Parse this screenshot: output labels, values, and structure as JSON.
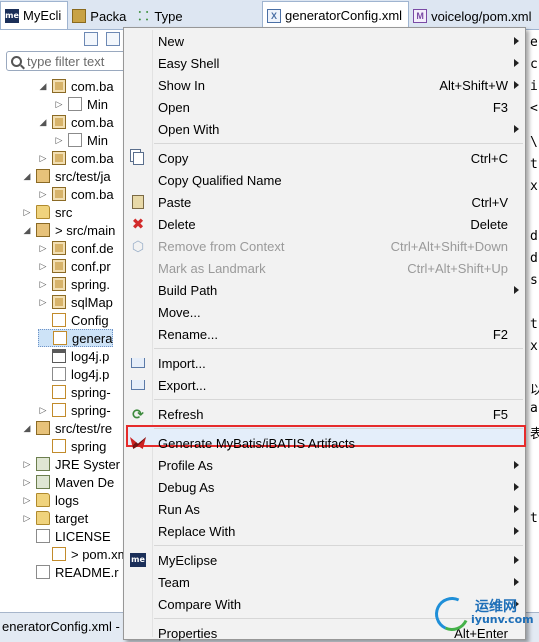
{
  "tabs_left": [
    {
      "label": "MyEcli",
      "icon": "myeclipse-icon"
    },
    {
      "label": "Packa",
      "icon": "package-explorer-icon"
    },
    {
      "label": "Type",
      "icon": "type-hierarchy-icon"
    }
  ],
  "tabs_right": [
    {
      "label": "generatorConfig.xml",
      "icon": "xml-file-icon"
    },
    {
      "label": "voicelog/pom.xml",
      "icon": "maven-pom-icon"
    }
  ],
  "explorer": {
    "filter_placeholder": "type filter text",
    "tree": [
      {
        "label": "com.ba",
        "icon": "package-icon",
        "arrow": "expanded"
      },
      {
        "label": "Min",
        "icon": "java-file-icon",
        "arrow": "collapsed"
      },
      {
        "label": "com.ba",
        "icon": "package-icon",
        "arrow": "expanded"
      },
      {
        "label": "Min",
        "icon": "java-file-icon",
        "arrow": "collapsed"
      },
      {
        "label": "com.ba",
        "icon": "package-icon",
        "arrow": "collapsed"
      },
      {
        "label": "src/test/ja",
        "icon": "source-folder-icon",
        "arrow": "expanded"
      },
      {
        "label": "com.ba",
        "icon": "package-icon",
        "arrow": "collapsed"
      },
      {
        "label": "src",
        "icon": "folder-icon",
        "arrow": "collapsed"
      },
      {
        "label": "> src/main",
        "icon": "source-folder-icon",
        "arrow": "expanded"
      },
      {
        "label": "conf.de",
        "icon": "package-icon",
        "arrow": "collapsed"
      },
      {
        "label": "conf.pr",
        "icon": "package-icon",
        "arrow": "collapsed"
      },
      {
        "label": "spring.",
        "icon": "package-icon",
        "arrow": "collapsed"
      },
      {
        "label": "sqlMap",
        "icon": "package-icon",
        "arrow": "collapsed"
      },
      {
        "label": "Config",
        "icon": "xml-file-icon",
        "arrow": "none"
      },
      {
        "label": "genera",
        "icon": "xml-file-icon",
        "arrow": "none",
        "selected": true
      },
      {
        "label": "log4j.p",
        "icon": "properties-file-icon",
        "arrow": "none"
      },
      {
        "label": "log4j.p",
        "icon": "file-icon",
        "arrow": "none"
      },
      {
        "label": "spring-",
        "icon": "xml-file-icon",
        "arrow": "none"
      },
      {
        "label": "spring-",
        "icon": "xml-file-icon",
        "arrow": "collapsed"
      },
      {
        "label": "src/test/re",
        "icon": "source-folder-icon",
        "arrow": "expanded"
      },
      {
        "label": "spring",
        "icon": "xml-file-icon",
        "arrow": "none"
      },
      {
        "label": "JRE Syster",
        "icon": "library-icon",
        "arrow": "collapsed"
      },
      {
        "label": "Maven De",
        "icon": "library-icon",
        "arrow": "collapsed"
      },
      {
        "label": "logs",
        "icon": "folder-icon",
        "arrow": "collapsed"
      },
      {
        "label": "target",
        "icon": "folder-icon",
        "arrow": "collapsed"
      },
      {
        "label": "LICENSE",
        "icon": "file-icon",
        "arrow": "none"
      },
      {
        "label": "> pom.xm",
        "icon": "maven-pom-icon",
        "arrow": "none"
      },
      {
        "label": "README.r",
        "icon": "file-icon",
        "arrow": "none"
      }
    ]
  },
  "editor_fragments": [
    "e",
    "c",
    "i",
    "<",
    "\\",
    "t",
    "x",
    "d",
    "d",
    "s",
    "t",
    "x",
    "以",
    "a",
    "表",
    "t"
  ],
  "context_menu": [
    {
      "label": "New",
      "shortcut": "",
      "submenu": true,
      "icon": "",
      "enabled": true
    },
    {
      "label": "Easy Shell",
      "shortcut": "",
      "submenu": true,
      "icon": "",
      "enabled": true
    },
    {
      "label": "Show In",
      "shortcut": "Alt+Shift+W",
      "submenu": true,
      "icon": "",
      "enabled": true
    },
    {
      "label": "Open",
      "shortcut": "F3",
      "submenu": false,
      "icon": "",
      "enabled": true
    },
    {
      "label": "Open With",
      "shortcut": "",
      "submenu": true,
      "icon": "",
      "enabled": true
    },
    {
      "sep": true
    },
    {
      "label": "Copy",
      "shortcut": "Ctrl+C",
      "submenu": false,
      "icon": "copy-icon",
      "enabled": true
    },
    {
      "label": "Copy Qualified Name",
      "shortcut": "",
      "submenu": false,
      "icon": "",
      "enabled": true
    },
    {
      "label": "Paste",
      "shortcut": "Ctrl+V",
      "submenu": false,
      "icon": "paste-icon",
      "enabled": true
    },
    {
      "label": "Delete",
      "shortcut": "Delete",
      "submenu": false,
      "icon": "delete-icon",
      "enabled": true
    },
    {
      "label": "Remove from Context",
      "shortcut": "Ctrl+Alt+Shift+Down",
      "submenu": false,
      "icon": "remove-context-icon",
      "enabled": false
    },
    {
      "label": "Mark as Landmark",
      "shortcut": "Ctrl+Alt+Shift+Up",
      "submenu": false,
      "icon": "",
      "enabled": false
    },
    {
      "label": "Build Path",
      "shortcut": "",
      "submenu": true,
      "icon": "",
      "enabled": true
    },
    {
      "label": "Move...",
      "shortcut": "",
      "submenu": false,
      "icon": "",
      "enabled": true
    },
    {
      "label": "Rename...",
      "shortcut": "F2",
      "submenu": false,
      "icon": "",
      "enabled": true
    },
    {
      "sep": true
    },
    {
      "label": "Import...",
      "shortcut": "",
      "submenu": false,
      "icon": "import-icon",
      "enabled": true
    },
    {
      "label": "Export...",
      "shortcut": "",
      "submenu": false,
      "icon": "export-icon",
      "enabled": true
    },
    {
      "sep": true
    },
    {
      "label": "Refresh",
      "shortcut": "F5",
      "submenu": false,
      "icon": "refresh-icon",
      "enabled": true
    },
    {
      "sep": true
    },
    {
      "label": "Generate MyBatis/iBATIS Artifacts",
      "shortcut": "",
      "submenu": false,
      "icon": "mybatis-icon",
      "enabled": true,
      "highlighted": true
    },
    {
      "label": "Profile As",
      "shortcut": "",
      "submenu": true,
      "icon": "",
      "enabled": true
    },
    {
      "label": "Debug As",
      "shortcut": "",
      "submenu": true,
      "icon": "",
      "enabled": true
    },
    {
      "label": "Run As",
      "shortcut": "",
      "submenu": true,
      "icon": "",
      "enabled": true
    },
    {
      "label": "Replace With",
      "shortcut": "",
      "submenu": true,
      "icon": "",
      "enabled": true
    },
    {
      "sep": true
    },
    {
      "label": "MyEclipse",
      "shortcut": "",
      "submenu": true,
      "icon": "myeclipse-icon",
      "enabled": true
    },
    {
      "label": "Team",
      "shortcut": "",
      "submenu": true,
      "icon": "",
      "enabled": true
    },
    {
      "label": "Compare With",
      "shortcut": "",
      "submenu": true,
      "icon": "",
      "enabled": true
    },
    {
      "sep": true
    },
    {
      "label": "Properties",
      "shortcut": "Alt+Enter",
      "submenu": false,
      "icon": "",
      "enabled": true
    }
  ],
  "status_bar": {
    "text": "eneratorConfig.xml - v"
  },
  "watermark": {
    "cn": "运维网",
    "en": "iyunv.com"
  },
  "colors": {
    "highlight_border": "#e62b2b",
    "menu_bg": "#f2f2f2",
    "selection": "#cde3f7"
  }
}
